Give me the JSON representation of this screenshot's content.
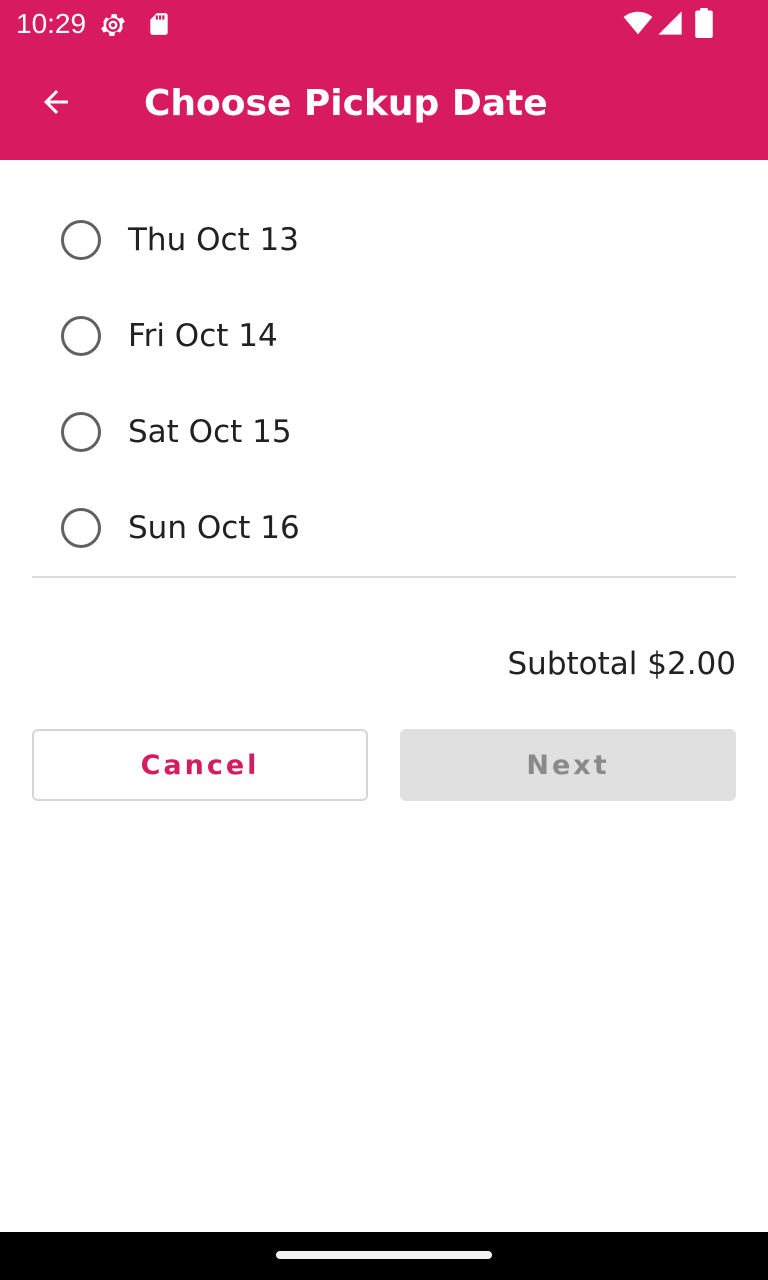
{
  "status_bar": {
    "time": "10:29",
    "icons": [
      "settings-gear-icon",
      "sd-card-icon",
      "wifi-icon",
      "cellular-signal-icon",
      "battery-icon"
    ]
  },
  "app_bar": {
    "back_icon": "arrow-back-icon",
    "title": "Choose Pickup Date"
  },
  "options": [
    {
      "label": "Thu Oct 13",
      "selected": false
    },
    {
      "label": "Fri Oct 14",
      "selected": false
    },
    {
      "label": "Sat Oct 15",
      "selected": false
    },
    {
      "label": "Sun Oct 16",
      "selected": false
    }
  ],
  "subtotal": "Subtotal $2.00",
  "buttons": {
    "cancel_label": "Cancel",
    "next_label": "Next",
    "next_enabled": false
  },
  "colors": {
    "primary": "#d81b60",
    "text": "#212121",
    "disabled_bg": "#e0e0e0",
    "disabled_text": "#8a8a8a"
  }
}
